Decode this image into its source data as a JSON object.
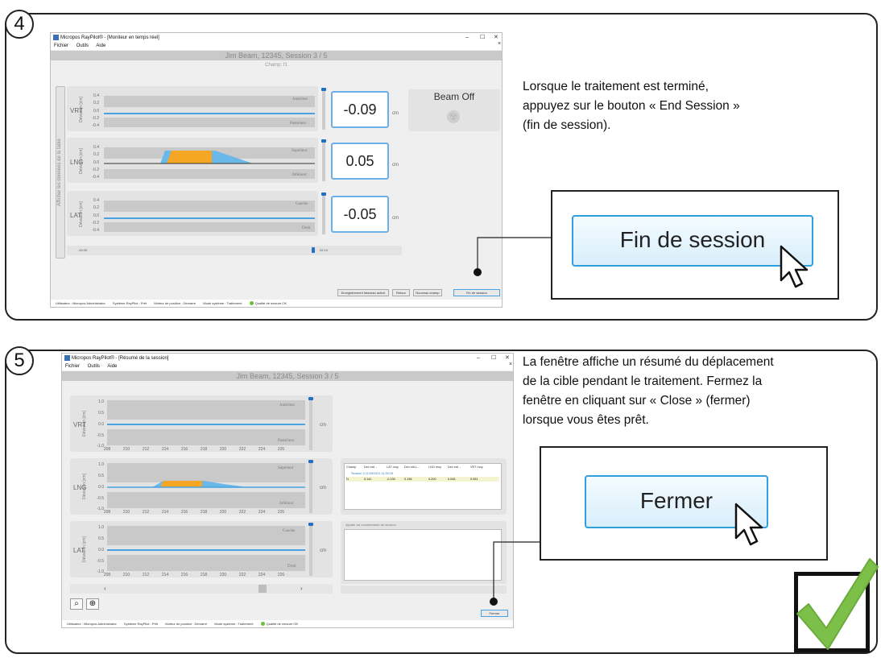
{
  "step4": {
    "number": "4",
    "window": {
      "title": "Micropos RayPilot® - [Moniteur en temps réel]",
      "menu": [
        "Fichier",
        "Outils",
        "Aide"
      ],
      "controls": [
        "–",
        "☐",
        "✕"
      ],
      "close_x": "×",
      "header": "Jim Beam, 12345, Session 3 / 5",
      "subheader": "Champ: f1",
      "side_toggle": "Afficher les données de la table",
      "axis_unit": "Déviation [cm]",
      "ticks": [
        "0.4",
        "0.2",
        "0.0",
        "-0.2",
        "-0.4"
      ],
      "rows": [
        {
          "label": "VRT",
          "top_dir": "Antérieur",
          "bottom_dir": "Postérieur",
          "value": "-0.09",
          "unit": "cm"
        },
        {
          "label": "LNG",
          "top_dir": "Supérieur",
          "bottom_dir": "Inférieur",
          "value": "0.05",
          "unit": "cm"
        },
        {
          "label": "LAT",
          "top_dir": "Gauche",
          "bottom_dir": "Droit",
          "value": "-0.05",
          "unit": "cm"
        }
      ],
      "beam_status": "Beam Off",
      "time_start": "-00:30",
      "time_end": "02:19",
      "buttons": [
        "Enregistrement faisceau activé",
        "Retour",
        "Nouveau champ",
        "Fin de session"
      ],
      "status": [
        "Utilisateur : Micropos Administrator",
        "Système RayPilot : Prêt",
        "Moteur de position : Démarré",
        "Mode système : Traitement",
        "Qualité de mesure OK"
      ]
    },
    "description": [
      "Lorsque le traitement est terminé,",
      "appuyez sur le bouton « End Session »",
      "(fin de session)."
    ],
    "callout_button": "Fin de session"
  },
  "step5": {
    "number": "5",
    "window": {
      "title": "Micropos RayPilot® - [Résumé de la session]",
      "menu": [
        "Fichier",
        "Outils",
        "Aide"
      ],
      "controls": [
        "–",
        "☐",
        "✕"
      ],
      "close_x": "×",
      "header": "Jim Beam, 12345, Session 3 / 5",
      "axis_unit": "Déviation [cm]",
      "ticks": [
        "1.0",
        "0.5",
        "0.0",
        "-0.5",
        "-1.0"
      ],
      "xticks": [
        "208",
        "210",
        "212",
        "214",
        "216",
        "218",
        "220",
        "222",
        "224",
        "226"
      ],
      "rows": [
        {
          "label": "VRT",
          "top_dir": "Antérieur",
          "bottom_dir": "Postérieur",
          "unit": "cm"
        },
        {
          "label": "LNG",
          "top_dir": "Supérieur",
          "bottom_dir": "Inférieur",
          "unit": "cm"
        },
        {
          "label": "LAT",
          "top_dir": "Gauche",
          "bottom_dir": "Droit",
          "unit": "cm"
        }
      ],
      "table": {
        "headers": [
          "Champ",
          "Dev std ...",
          "LAT moy",
          "Dev std L...",
          "LNG moy",
          "Dev std ...",
          "VRT moy"
        ],
        "session_line": "Session 3 11/26/2021 11:35:28",
        "row": [
          "f1",
          "0.141",
          "-0.130",
          "0.136",
          "0.200",
          "0.045",
          "0.051"
        ]
      },
      "comment_placeholder": "Ajouter un commentaire de session",
      "scroll_left": "‹",
      "scroll_right": "›",
      "zoom_out": "⌕",
      "zoom_fit": "⊕",
      "close_button": "Fermer",
      "status": [
        "Utilisateur : Micropos Administrator",
        "Système RayPilot : Prêt",
        "Moteur de position : Démarré",
        "Mode système : Traitement",
        "Qualité de mesure OK"
      ]
    },
    "description": [
      "La fenêtre affiche un résumé du déplacement",
      "de la cible pendant le traitement. Fermez la",
      "fenêtre en cliquant sur « Close » (fermer)",
      "lorsque vous êtes prêt."
    ],
    "callout_button": "Fermer"
  },
  "colors": {
    "accent_blue": "#4aa3e0",
    "orange": "#f5a623",
    "check_green": "#7cc04a"
  }
}
